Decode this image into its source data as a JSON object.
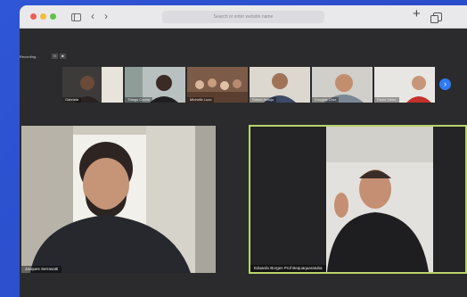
{
  "browser": {
    "address_placeholder": "Search or enter website name"
  },
  "recording": {
    "label": "Recording...",
    "pause_glyph": "II",
    "stop_glyph": "■"
  },
  "thumbnails": [
    {
      "name": "Gabriela"
    },
    {
      "name": "Thiago Cunha"
    },
    {
      "name": "Michelle Luzo"
    },
    {
      "name": "Rafael Araújo"
    },
    {
      "name": "Douglas Cruz"
    },
    {
      "name": "Paulo Vieira"
    }
  ],
  "next_glyph": "›",
  "tiles": {
    "left": {
      "name": "Jacques Serrasatti"
    },
    "right": {
      "name": "Eduardo Borges Prof Bequaquaratuba"
    }
  },
  "colors": {
    "accent": "#2d7cf6",
    "active_speaker_border": "#b9d36a",
    "background": "#2f56d6"
  }
}
